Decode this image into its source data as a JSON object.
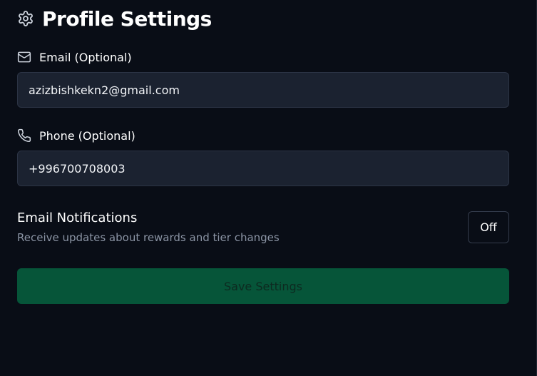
{
  "header": {
    "title": "Profile Settings",
    "icon": "gear-icon"
  },
  "email": {
    "label": "Email (Optional)",
    "icon": "mail-icon",
    "value": "azizbishkekn2@gmail.com"
  },
  "phone": {
    "label": "Phone (Optional)",
    "icon": "phone-icon",
    "value": "+996700708003"
  },
  "notifications": {
    "title": "Email Notifications",
    "description": "Receive updates about rewards and tier changes",
    "toggle_label": "Off"
  },
  "actions": {
    "save_label": "Save Settings"
  },
  "colors": {
    "background": "#090d16",
    "input_background": "#1b2230",
    "save_button": "#065539",
    "muted_text": "#8b94a4"
  }
}
